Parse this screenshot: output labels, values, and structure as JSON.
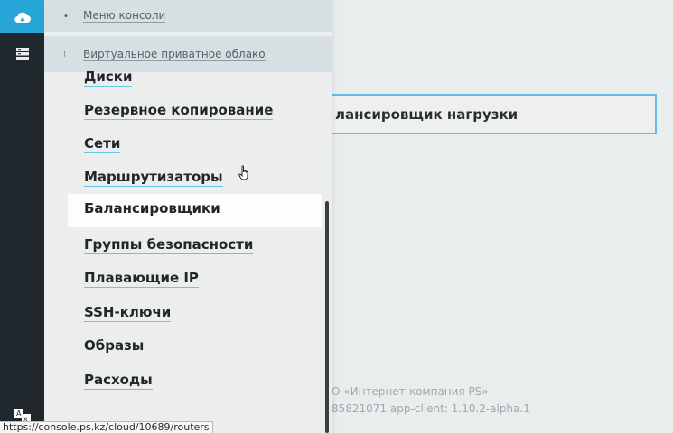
{
  "panel": {
    "header_items": [
      {
        "label": "Меню консоли"
      },
      {
        "label": "Виртуальное приватное облако"
      }
    ],
    "menu_items": [
      {
        "label": "Диски",
        "active": false
      },
      {
        "label": "Резервное копирование",
        "active": false
      },
      {
        "label": "Сети",
        "active": false
      },
      {
        "label": "Маршрутизаторы",
        "active": false
      },
      {
        "label": "Балансировщики",
        "active": true
      },
      {
        "label": "Группы безопасности",
        "active": false
      },
      {
        "label": "Плавающие IP",
        "active": false
      },
      {
        "label": "SSH-ключи",
        "active": false
      },
      {
        "label": "Образы",
        "active": false
      },
      {
        "label": "Расходы",
        "active": false
      }
    ]
  },
  "background": {
    "card_title": "лансировщик нагрузки",
    "footer_line1": "О «Интернет-компания PS»",
    "footer_line2": "85821071 app-client: 1.10.2-alpha.1"
  },
  "status_url": "https://console.ps.kz/cloud/10689/routers",
  "icons": {
    "rail_top": "cloud-icon",
    "rail_second": "server-stack-icon",
    "rail_bottom": "translate-icon",
    "pointer": "hand-pointer-icon"
  },
  "colors": {
    "accent": "#27a5d9",
    "rail": "#21282d",
    "link_underline": "#68c4e6"
  }
}
